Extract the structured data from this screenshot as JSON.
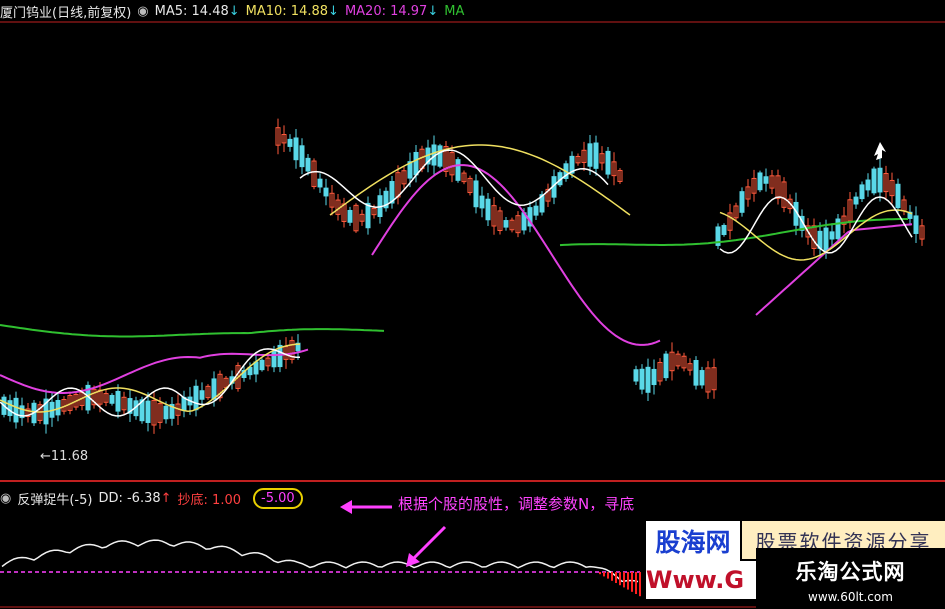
{
  "header": {
    "stock_name": "厦门钨业(日线,前复权)",
    "ma5": "MA5: 14.48",
    "ma10": "MA10: 14.88",
    "ma20": "MA20: 14.97",
    "ma_more": "MA",
    "down_arrow": "↓"
  },
  "price_low_label": "11.68",
  "indicator": {
    "name": "反弹捉牛(-5)",
    "dd": "DD: -6.38",
    "up_arrow": "↑",
    "chaodi": "抄底: 1.00",
    "level": "-5.00"
  },
  "annotation": "根据个股的股性，调整参数N，寻底",
  "watermarks": {
    "gu_hai_wang": "股海网",
    "software": "股票软件资源分享",
    "www": "Www.G",
    "letao": "乐淘公式网",
    "letao_url": "www.60lt.com"
  },
  "colors": {
    "up_candle": "#ff5a3c",
    "down_candle": "#5ad8e8",
    "ma5": "#ffffff",
    "ma10": "#f0e060",
    "ma20": "#e040e0",
    "ma60": "#30c030",
    "border": "#c02020"
  }
}
